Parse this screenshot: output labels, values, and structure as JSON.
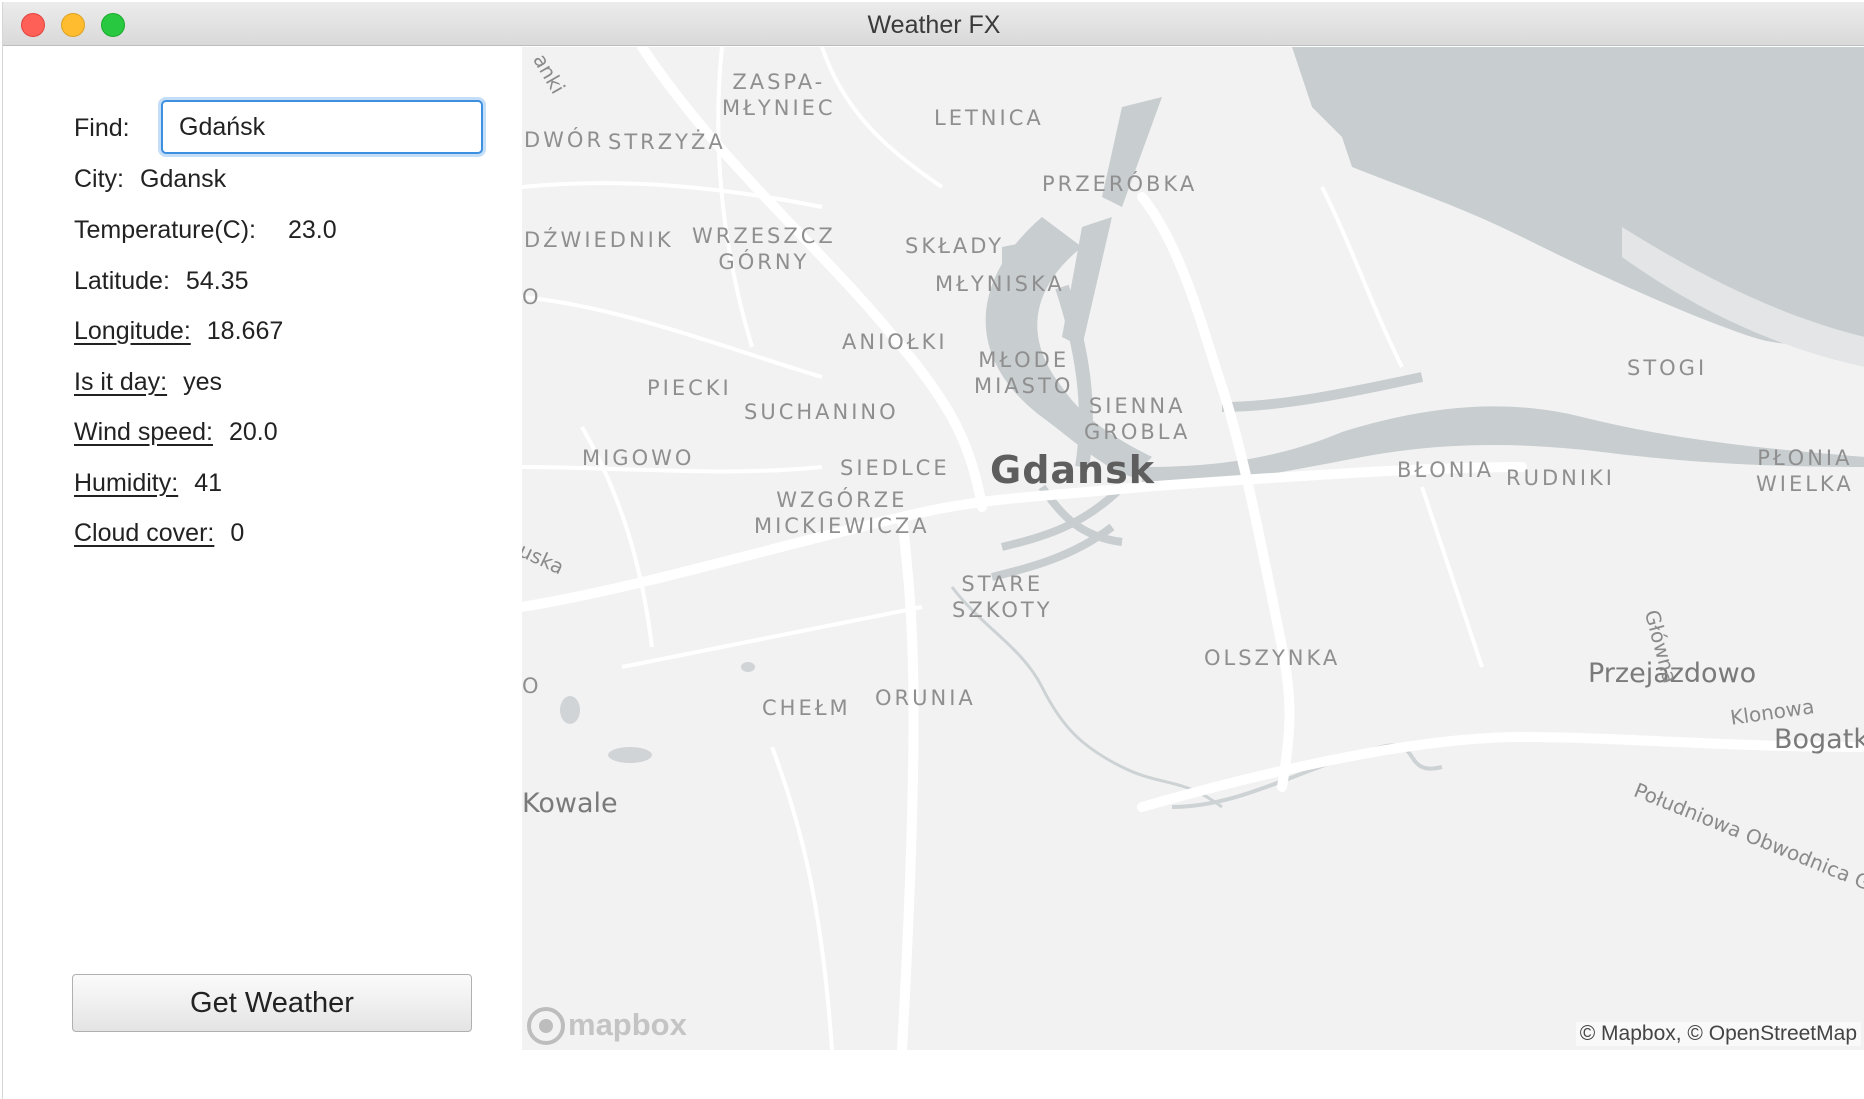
{
  "window": {
    "title": "Weather FX"
  },
  "form": {
    "find_label": "Find:",
    "find_value": "Gdańsk",
    "button_label": "Get Weather"
  },
  "fields": [
    {
      "label": "City:",
      "value": "Gdansk"
    },
    {
      "label": "Temperature(C):",
      "value": "23.0"
    },
    {
      "label": "Latitude:",
      "value": "54.35"
    },
    {
      "label": "Longitude:",
      "value": "18.667"
    },
    {
      "label": "Is it day:",
      "value": "yes"
    },
    {
      "label": "Wind speed:",
      "value": "20.0"
    },
    {
      "label": "Humidity:",
      "value": "41"
    },
    {
      "label": "Cloud cover:",
      "value": "0"
    }
  ],
  "map": {
    "city": "Gdansk",
    "districts": {
      "zaspa": "ZASPA-\nMŁYNIEC",
      "letnica": "LETNICA",
      "dwor": "DWÓR",
      "strzyza": "STRZYŻA",
      "przerobka": "PRZERÓBKA",
      "dzwiednik": "DŹWIEDNIK",
      "wrzeszcz": "WRZESZCZ\nGÓRNY",
      "sklady": "SKŁADY",
      "mlyniska": "MŁYNISKA",
      "aniolki": "ANIOŁKI",
      "stogi": "STOGI",
      "piecki": "PIECKI",
      "mlode_miasto": "MŁODE\nMIASTO",
      "suchanino": "SUCHANINO",
      "sienna_grobla": "SIENNA\nGROBLA",
      "migowo": "MIGOWO",
      "siedlce": "SIEDLCE",
      "blonia": "BŁONIA",
      "rudniki": "RUDNIKI",
      "plonia": "PŁONIA\nWIELKA",
      "wzgorze": "WZGÓRZE\nMICKIEWICZA",
      "stare_szkoty": "STARE\nSZKOTY",
      "olszynka": "OLSZYNKA",
      "chelm": "CHEŁM",
      "orunia": "ORUNIA"
    },
    "towns": {
      "przejazdowo": "Przejazdowo",
      "bogatka": "Bogatka",
      "kowale": "Kowale"
    },
    "roads": {
      "glowna": "Główna",
      "klonowa": "Klonowa",
      "obwodnica": "Południowa Obwodnica G",
      "anki": "anki",
      "uska": "uska"
    },
    "edge_letter": "O",
    "edge_letter_2": "O",
    "logo_text": "mapbox",
    "attribution": "© Mapbox, © OpenStreetMap"
  },
  "colors": {
    "map_bg": "#f2f2f2",
    "water": "#c8cdd0",
    "road": "#ffffff",
    "focus_ring": "#3d8fe0"
  }
}
